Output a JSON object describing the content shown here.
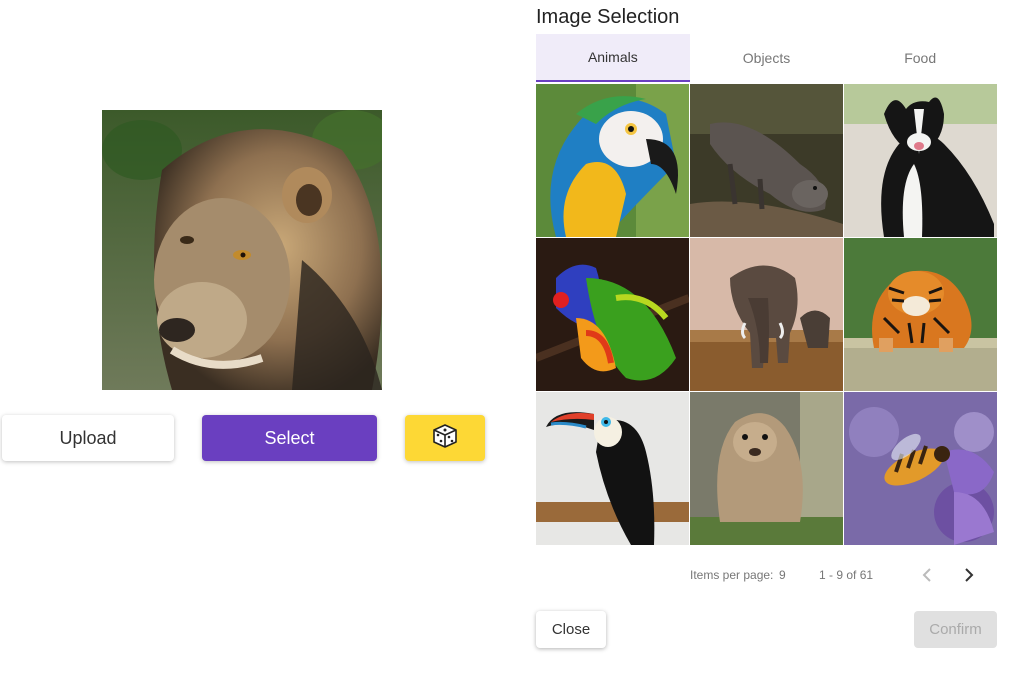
{
  "left": {
    "preview_image": "lion-photo",
    "upload_label": "Upload",
    "select_label": "Select",
    "random_icon": "dice-icon",
    "colors": {
      "select": "#6a3fc0",
      "random": "#fdd835"
    }
  },
  "dialog": {
    "title": "Image Selection",
    "tabs": [
      {
        "label": "Animals",
        "active": true
      },
      {
        "label": "Objects",
        "active": false
      },
      {
        "label": "Food",
        "active": false
      }
    ],
    "images": [
      "macaw",
      "otter",
      "border-collie",
      "lorikeet",
      "elephant",
      "tiger",
      "toucan",
      "marmot",
      "bee-on-flower"
    ],
    "paginator": {
      "items_per_page_label": "Items per page:",
      "page_size": "9",
      "range": "1 - 9 of 61",
      "prev_icon": "chevron-left-icon",
      "next_icon": "chevron-right-icon"
    },
    "close_label": "Close",
    "confirm_label": "Confirm"
  }
}
